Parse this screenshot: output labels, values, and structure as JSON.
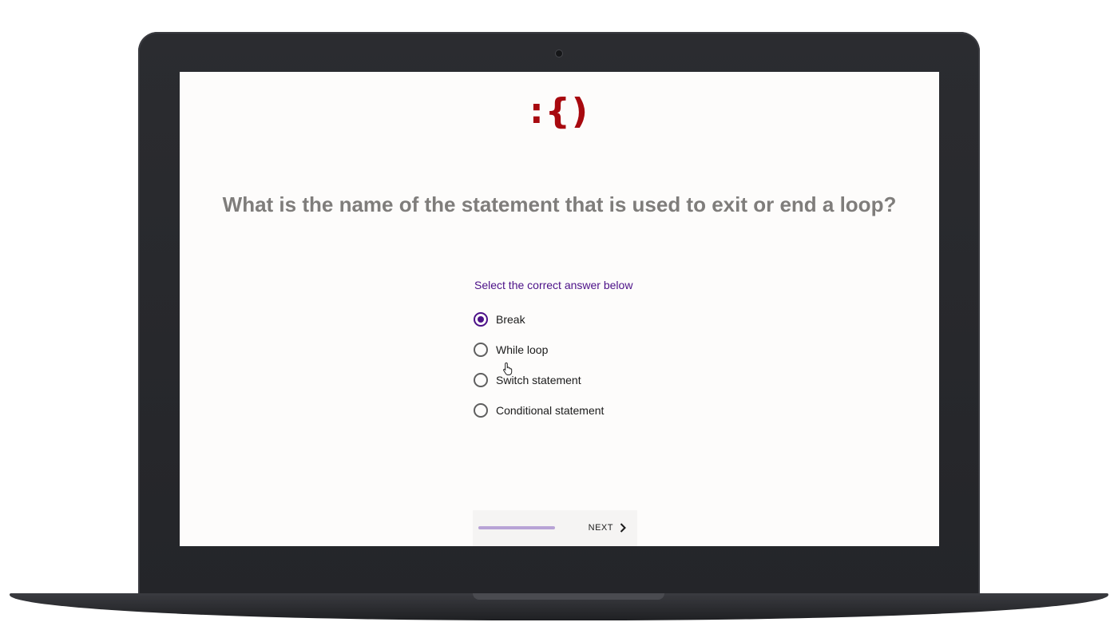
{
  "logo": {
    "text": ":{)",
    "color": "#a8090f"
  },
  "question": {
    "text": "What is the name of the statement that is used to exit or end a loop?"
  },
  "answers": {
    "prompt": "Select the correct answer below",
    "selected_index": 0,
    "options": [
      {
        "label": "Break",
        "selected": true
      },
      {
        "label": "While loop",
        "selected": false
      },
      {
        "label": "Switch statement",
        "selected": false
      },
      {
        "label": "Conditional statement",
        "selected": false
      }
    ]
  },
  "footer": {
    "progress": 1.0,
    "next_label": "NEXT",
    "next_icon": "chevron-right-icon"
  },
  "colors": {
    "accent": "#4c1188",
    "question_text": "#7f7d7b",
    "progress": "#b8a3d6"
  }
}
